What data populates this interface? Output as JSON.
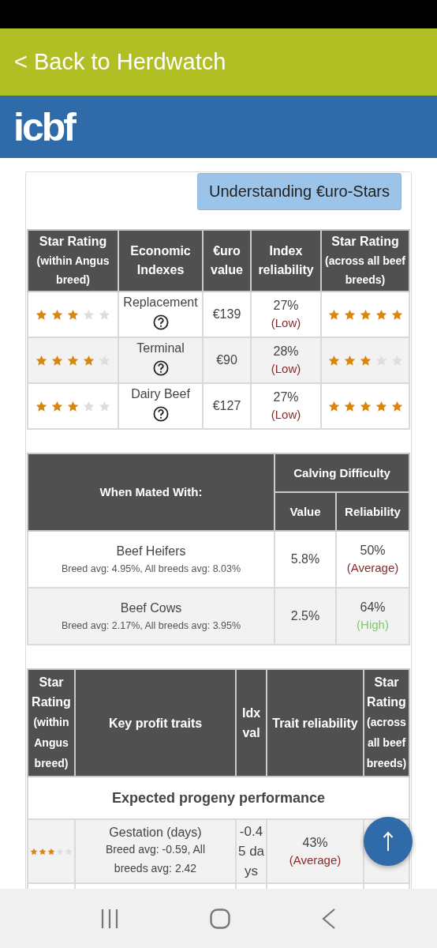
{
  "back_link": "< Back to Herdwatch",
  "logo": "icbf",
  "understanding_button": "Understanding €uro-Stars",
  "index_table": {
    "columns": [
      {
        "title": "Star Rating",
        "subtitle": "(within Angus breed)"
      },
      {
        "title": "Economic Indexes"
      },
      {
        "title": "€uro value"
      },
      {
        "title": "Index reliability"
      },
      {
        "title": "Star Rating",
        "subtitle": "(across all beef breeds)"
      }
    ],
    "rows": [
      {
        "within_breed": {
          "stars": 3
        },
        "index": "Replacement",
        "value": "€139",
        "reliability": {
          "value": "27%",
          "label": "(Low)",
          "color": "#8c2a2a"
        },
        "across_breeds": {
          "stars": 5
        }
      },
      {
        "within_breed": {
          "stars": 4
        },
        "index": "Terminal",
        "value": "€90",
        "reliability": {
          "value": "28%",
          "label": "(Low)",
          "color": "#8c2a2a"
        },
        "across_breeds": {
          "stars": 3
        }
      },
      {
        "within_breed": {
          "stars": 3
        },
        "index": "Dairy Beef",
        "value": "€127",
        "reliability": {
          "value": "27%",
          "label": "(Low)",
          "color": "#8c2a2a"
        },
        "across_breeds": {
          "stars": 5
        }
      }
    ]
  },
  "calving_table": {
    "first_column": "When Mated With:",
    "group": "Calving Difficulty",
    "sub_columns": [
      "Value",
      "Reliability"
    ],
    "rows": [
      {
        "name": "Beef Heifers",
        "detail": "Breed avg: 4.95%, All breeds avg: 8.03%",
        "value": "5.8%",
        "reliability": {
          "value": "50%",
          "label": "(Average)",
          "color": "#8c2a2a"
        }
      },
      {
        "name": "Beef Cows",
        "detail": "Breed avg: 2.17%, All breeds avg: 3.95%",
        "value": "2.5%",
        "reliability": {
          "value": "64%",
          "label": "(High)",
          "color": "#7fc96a"
        }
      }
    ]
  },
  "traits_table": {
    "columns": [
      {
        "title": "Star Rating",
        "subtitle": "(within Angus breed)"
      },
      {
        "title": "Key profit traits"
      },
      {
        "title": "Idx val"
      },
      {
        "title": "Trait reliability"
      },
      {
        "title": "Star Rating",
        "subtitle": "(across all beef breeds)"
      }
    ],
    "section": "Expected progeny performance",
    "rows": [
      {
        "within_breed": {
          "stars": 3
        },
        "trait": "Gestation (days)",
        "detail": "Breed avg: -0.59, All breeds avg: 2.42",
        "value": "-0.45 days",
        "reliability": {
          "value": "43%",
          "label": "(Average)",
          "color": "#8c2a2a"
        }
      }
    ]
  }
}
